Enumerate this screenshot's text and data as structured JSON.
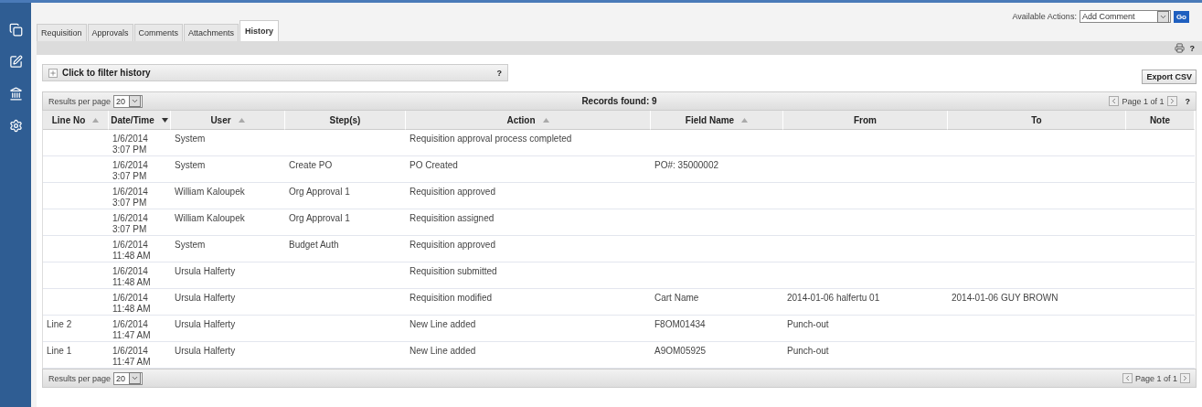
{
  "sidebar": {
    "items": [
      {
        "kind": "copy"
      },
      {
        "kind": "edit"
      },
      {
        "kind": "bank"
      },
      {
        "kind": "settings"
      }
    ]
  },
  "available_actions": {
    "label": "Available Actions:",
    "value": "Add Comment",
    "go": "Go"
  },
  "tabs": [
    {
      "label": "Requisition",
      "selected": false
    },
    {
      "label": "Approvals",
      "selected": false
    },
    {
      "label": "Comments",
      "selected": false
    },
    {
      "label": "Attachments",
      "selected": false
    },
    {
      "label": "History",
      "selected": true
    }
  ],
  "toolbar": {
    "help": "?"
  },
  "filter": {
    "label": "Click to filter history",
    "expanded": false,
    "help": "?"
  },
  "export_button": "Export CSV",
  "pager_top": {
    "results_label": "Results per page",
    "per_page": "20",
    "records": "Records found: 9",
    "page": "Page 1 of 1",
    "help": "?"
  },
  "table": {
    "columns": [
      {
        "label": "Line No",
        "sortable": true,
        "sorted": false
      },
      {
        "label": "Date/Time",
        "sortable": true,
        "sorted": true
      },
      {
        "label": "User",
        "sortable": true,
        "sorted": false
      },
      {
        "label": "Step(s)",
        "sortable": false,
        "sorted": false
      },
      {
        "label": "Action",
        "sortable": true,
        "sorted": false
      },
      {
        "label": "Field Name",
        "sortable": true,
        "sorted": false
      },
      {
        "label": "From",
        "sortable": false,
        "sorted": false
      },
      {
        "label": "To",
        "sortable": false,
        "sorted": false
      },
      {
        "label": "Note",
        "sortable": false,
        "sorted": false
      }
    ],
    "rows": [
      [
        "",
        "1/6/2014 3:07 PM",
        "System",
        "",
        "Requisition approval process completed",
        "",
        "",
        "",
        ""
      ],
      [
        "",
        "1/6/2014 3:07 PM",
        "System",
        "Create PO",
        "PO Created",
        "PO#: 35000002",
        "",
        "",
        ""
      ],
      [
        "",
        "1/6/2014 3:07 PM",
        "William Kaloupek",
        "Org Approval 1",
        "Requisition approved",
        "",
        "",
        "",
        ""
      ],
      [
        "",
        "1/6/2014 3:07 PM",
        "William Kaloupek",
        "Org Approval 1",
        "Requisition assigned",
        "",
        "",
        "",
        ""
      ],
      [
        "",
        "1/6/2014 11:48 AM",
        "System",
        "Budget Auth",
        "Requisition approved",
        "",
        "",
        "",
        ""
      ],
      [
        "",
        "1/6/2014 11:48 AM",
        "Ursula Halferty",
        "",
        "Requisition submitted",
        "",
        "",
        "",
        ""
      ],
      [
        "",
        "1/6/2014 11:48 AM",
        "Ursula Halferty",
        "",
        "Requisition modified",
        "Cart Name",
        "2014-01-06 halfertu 01",
        "2014-01-06 GUY BROWN",
        ""
      ],
      [
        "Line 2",
        "1/6/2014 11:47 AM",
        "Ursula Halferty",
        "",
        "New Line added",
        "F8OM01434",
        "Punch-out",
        "",
        ""
      ],
      [
        "Line 1",
        "1/6/2014 11:47 AM",
        "Ursula Halferty",
        "",
        "New Line added",
        "A9OM05925",
        "Punch-out",
        "",
        ""
      ]
    ]
  },
  "pager_bottom": {
    "results_label": "Results per page",
    "per_page": "20",
    "page": "Page 1 of 1"
  }
}
